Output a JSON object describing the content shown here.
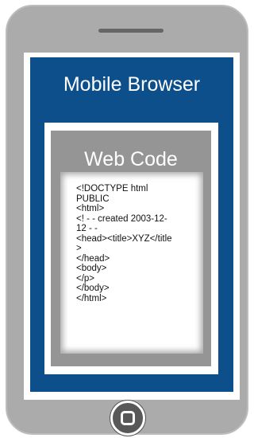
{
  "browser": {
    "title": "Mobile Browser"
  },
  "page": {
    "title": "Web Code",
    "code_lines": [
      "<!DOCTYPE html",
      "PUBLIC",
      "<html>",
      "<! - - created 2003-12-",
      "12 - -",
      "<head><title>XYZ</title",
      ">",
      "</head>",
      "<body>",
      "</p>",
      "</body>",
      "</html>"
    ]
  },
  "device": {
    "home_button_icon": "home-square-icon"
  },
  "colors": {
    "phone_body": "#ababab",
    "screen": "#0c4f8a",
    "page": "#959595"
  }
}
